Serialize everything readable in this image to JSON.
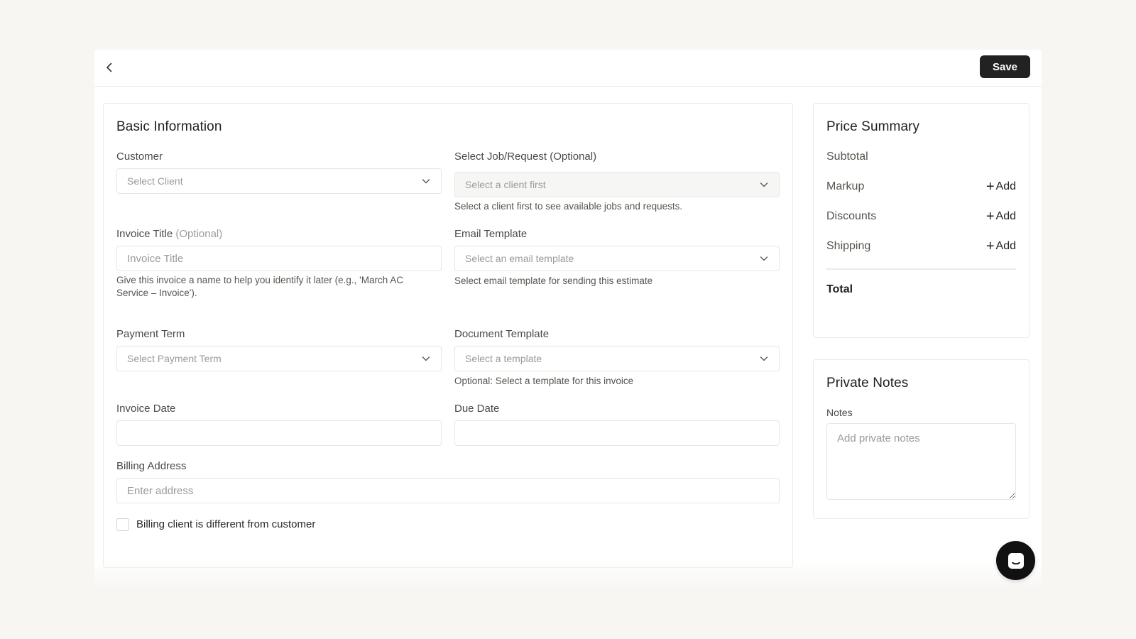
{
  "header": {
    "back_icon": "chevron-left-icon",
    "save_label": "Save"
  },
  "basic_info": {
    "title": "Basic Information",
    "customer": {
      "label": "Customer",
      "placeholder": "Select Client"
    },
    "job_request": {
      "label": "Select Job/Request (Optional)",
      "placeholder": "Select a client first",
      "help": "Select a client first to see available jobs and requests."
    },
    "invoice_title": {
      "label": "Invoice Title",
      "optional": "(Optional)",
      "placeholder": "Invoice Title",
      "help": "Give this invoice a name to help you identify it later (e.g., 'March AC Service – Invoice')."
    },
    "email_template": {
      "label": "Email Template",
      "placeholder": "Select an email template",
      "help": "Select email template for sending this estimate"
    },
    "payment_term": {
      "label": "Payment Term",
      "placeholder": "Select Payment Term"
    },
    "document_template": {
      "label": "Document Template",
      "placeholder": "Select a template",
      "help": "Optional: Select a template for this invoice"
    },
    "invoice_date": {
      "label": "Invoice Date",
      "value": ""
    },
    "due_date": {
      "label": "Due Date",
      "value": ""
    },
    "billing_address": {
      "label": "Billing Address",
      "placeholder": "Enter address"
    },
    "billing_checkbox": {
      "label": "Billing client is different from customer",
      "checked": false
    }
  },
  "price_summary": {
    "title": "Price Summary",
    "subtotal": "Subtotal",
    "markup": "Markup",
    "discounts": "Discounts",
    "shipping": "Shipping",
    "add_label": "Add",
    "add_icon": "plus-icon",
    "total": "Total"
  },
  "private_notes": {
    "title": "Private Notes",
    "notes_label": "Notes",
    "placeholder": "Add private notes"
  },
  "chat": {
    "icon": "chat-icon"
  },
  "colors": {
    "page_bg": "#f7f6f3",
    "card_border": "#ebeae7",
    "primary_button": "#222222",
    "chat_button": "#111111"
  }
}
